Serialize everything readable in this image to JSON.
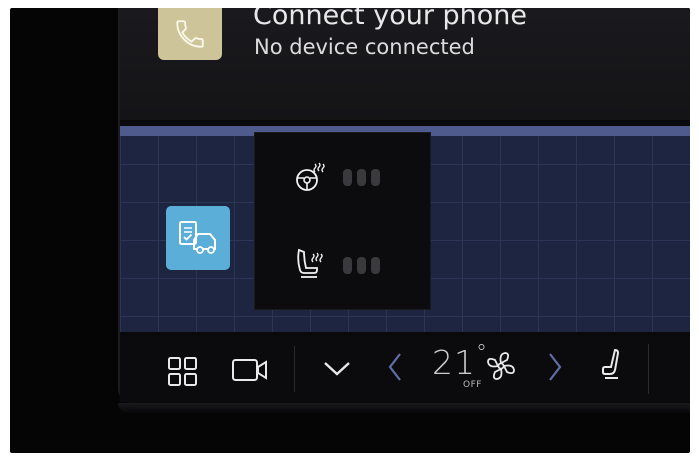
{
  "phone": {
    "title": "Connect your phone",
    "status": "No device connected",
    "icon": "phone-icon"
  },
  "apps": {
    "service_icon": "car-service-icon"
  },
  "heating": {
    "steering_wheel": {
      "icon": "steering-wheel-heat-icon",
      "level": 0,
      "max_level": 3
    },
    "seat": {
      "icon": "seat-heat-icon",
      "level": 0,
      "max_level": 3
    }
  },
  "climate": {
    "home_icon": "grid-home-icon",
    "camera_icon": "camera-icon",
    "collapse_icon": "chevron-down-icon",
    "temp_down_icon": "chevron-left-icon",
    "temperature": "21",
    "temperature_unit": "°",
    "fan_icon": "fan-icon",
    "fan_status": "OFF",
    "temp_up_icon": "chevron-right-icon",
    "seat_icon": "seat-icon"
  },
  "colors": {
    "phone_tile": "#cdc49a",
    "service_tile": "#5aaed8",
    "map_background": "#1d2540"
  }
}
